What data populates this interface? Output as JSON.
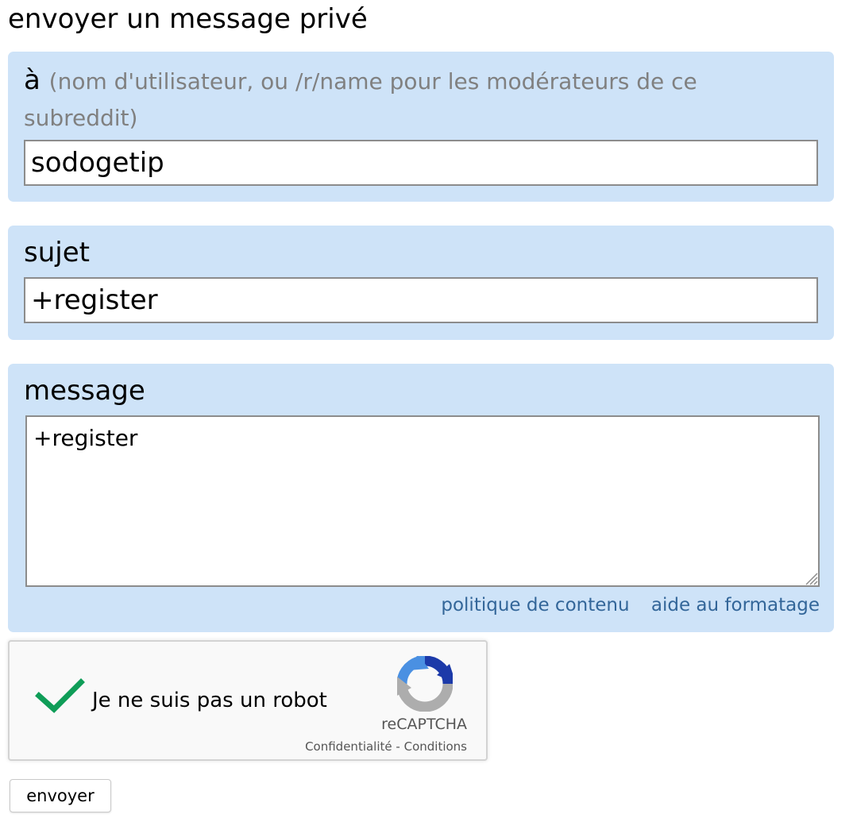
{
  "page": {
    "title": "envoyer un message privé"
  },
  "to_field": {
    "label": "à",
    "hint": "(nom d'utilisateur, ou /r/name pour les modérateurs de ce subreddit)",
    "value": "sodogetip"
  },
  "subject_field": {
    "label": "sujet",
    "value": "+register"
  },
  "message_field": {
    "label": "message",
    "value": "+register",
    "links": {
      "content_policy": "politique de contenu",
      "formatting_help": "aide au formatage"
    }
  },
  "captcha": {
    "label": "Je ne suis pas un robot",
    "checked": true,
    "brand": "reCAPTCHA",
    "privacy": "Confidentialité",
    "separator": " - ",
    "terms": "Conditions",
    "colors": {
      "check": "#0f9d58",
      "logo_blue": "#4a90e2",
      "logo_dark": "#1c3aa9",
      "logo_gray": "#adadad"
    }
  },
  "submit": {
    "label": "envoyer"
  },
  "colors": {
    "panel_bg": "#cee3f8",
    "hint_text": "#808080",
    "link": "#336699"
  }
}
